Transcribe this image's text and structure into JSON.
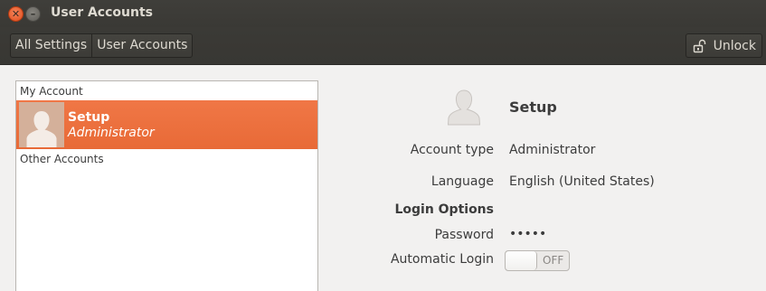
{
  "window": {
    "title": "User Accounts",
    "close_icon": "close-icon",
    "minimize_icon": "minimize-icon"
  },
  "toolbar": {
    "breadcrumbs": [
      "All Settings",
      "User Accounts"
    ],
    "unlock_label": "Unlock",
    "unlock_icon": "lock-icon"
  },
  "accounts_list": {
    "my_account_header": "My Account",
    "selected_user": {
      "name": "Setup",
      "role": "Administrator",
      "avatar_icon": "user-avatar-icon"
    },
    "other_accounts_header": "Other Accounts",
    "highlight_color": "#e96d3a"
  },
  "details": {
    "name": "Setup",
    "avatar_icon": "user-avatar-icon",
    "account_type_label": "Account type",
    "account_type_value": "Administrator",
    "language_label": "Language",
    "language_value": "English (United States)",
    "login_options_heading": "Login Options",
    "password_label": "Password",
    "password_value": "•••••",
    "automatic_login_label": "Automatic Login",
    "automatic_login_state": "OFF"
  }
}
